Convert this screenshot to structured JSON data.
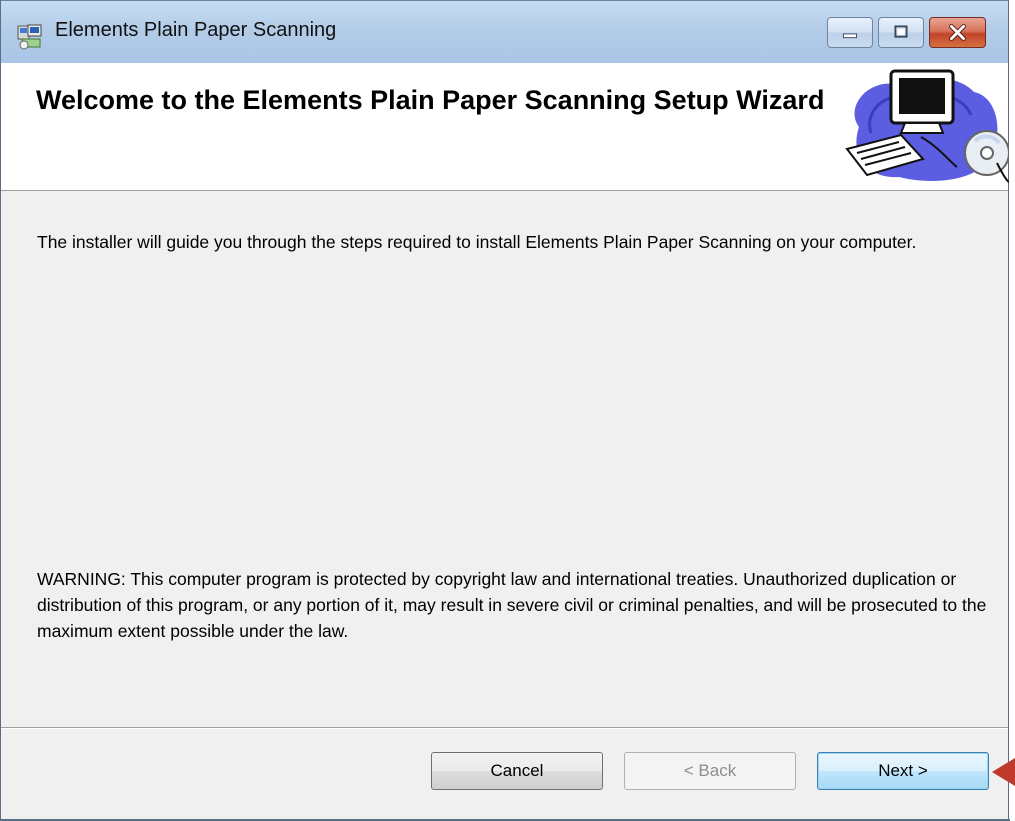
{
  "window": {
    "title": "Elements Plain Paper Scanning",
    "controls": {
      "minimize": "minimize",
      "maximize": "maximize",
      "close": "close"
    }
  },
  "header": {
    "title": "Welcome to the Elements Plain Paper Scanning Setup Wizard",
    "art_icon": "computer-cd-clipart"
  },
  "content": {
    "intro": "The installer will guide you through the steps required to install Elements Plain Paper Scanning on your computer.",
    "warning": "WARNING: This computer program is protected by copyright law and international treaties. Unauthorized duplication or distribution of this program, or any portion of it, may result in severe civil or criminal penalties, and will be prosecuted to the maximum extent possible under the law."
  },
  "buttons": {
    "cancel": "Cancel",
    "back": "< Back",
    "next": "Next >"
  },
  "colors": {
    "titlebar": "#b9d1ea",
    "close_button": "#c7452b",
    "pointer_arrow": "#c0392b"
  }
}
